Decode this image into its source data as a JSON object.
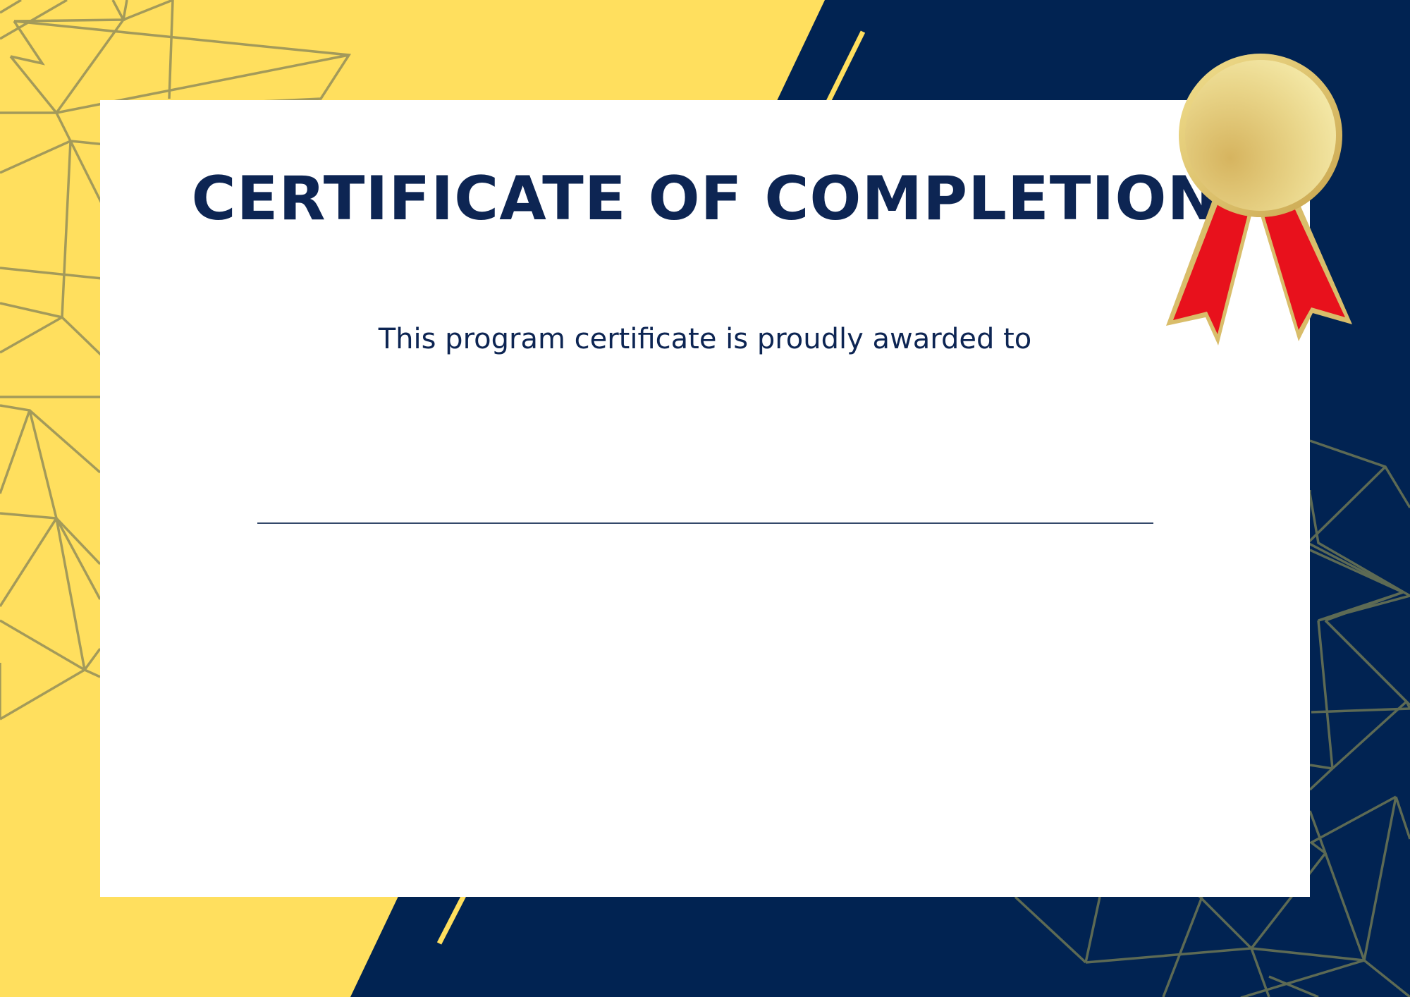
{
  "certificate": {
    "title": "CERTIFICATE OF COMPLETION",
    "subtitle": "This program certificate is proudly awarded to",
    "recipient_name": ""
  },
  "colors": {
    "navy": "#012352",
    "yellow": "#ffdf5e",
    "text_navy": "#0d2553",
    "ribbon_red": "#e8111c",
    "medal_gold": "#e6cf7d",
    "geo_line_on_yellow": "#a39a5a",
    "geo_line_on_navy": "#5d6a54"
  },
  "icons": {
    "medal": "award-ribbon-medal-icon"
  }
}
